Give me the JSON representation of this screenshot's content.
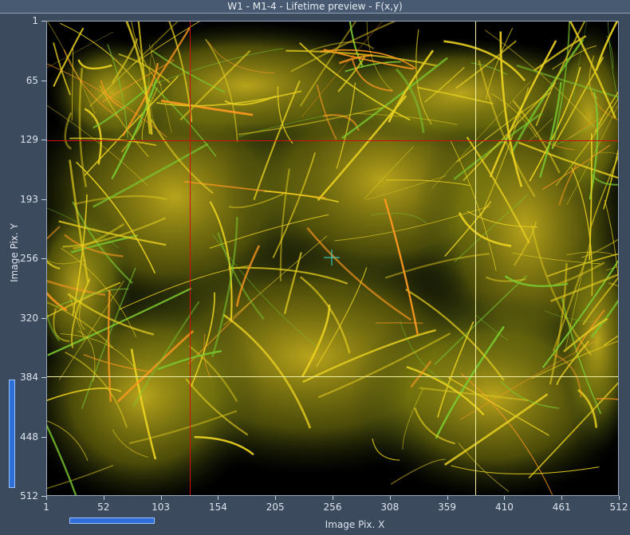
{
  "window": {
    "title": "W1 - M1-4 - Lifetime preview  - F(x,y)"
  },
  "plot": {
    "xlabel": "Image Pix. X",
    "ylabel": "Image Pix. Y",
    "xticks": [
      "1",
      "52",
      "103",
      "154",
      "205",
      "256",
      "308",
      "359",
      "410",
      "461",
      "512"
    ],
    "yticks": [
      "1",
      "65",
      "129",
      "193",
      "256",
      "320",
      "384",
      "448",
      "512"
    ],
    "cursors": {
      "red_x": 129,
      "red_y": 129,
      "yellow_x": 384,
      "yellow_y": 384,
      "marker_x": 256,
      "marker_y": 256
    },
    "colors": {
      "red_cursor": "#d01010",
      "yellow_cursor": "#f0f0a0",
      "marker": "#40e0d0",
      "fibers": "#e8d020"
    }
  }
}
